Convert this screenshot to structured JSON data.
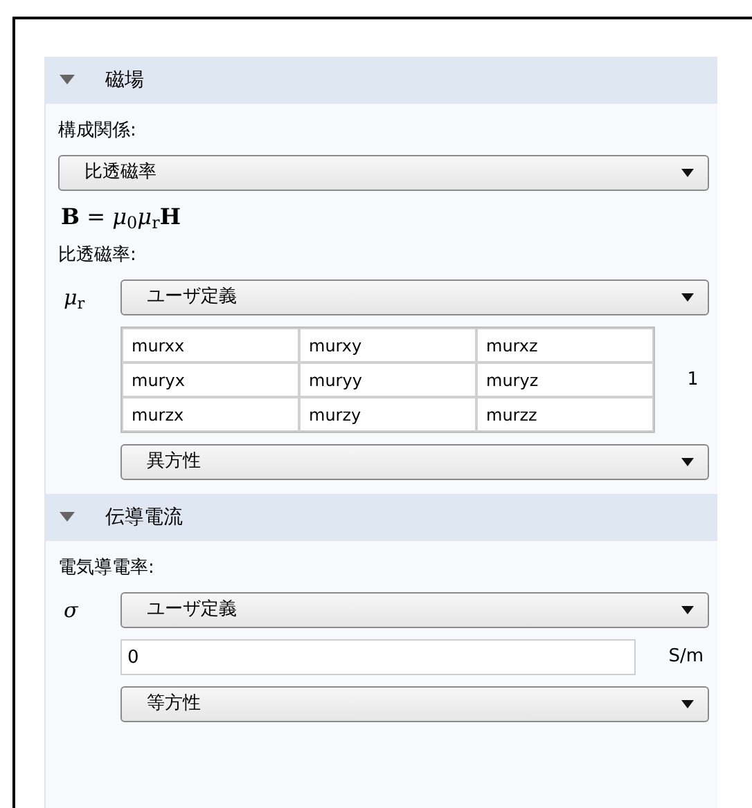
{
  "sections": [
    {
      "title": "磁場",
      "expanded": true,
      "items": [
        {
          "kind": "label",
          "text": "構成関係:"
        },
        {
          "kind": "dropdown",
          "value": "比透磁率"
        },
        {
          "kind": "formula",
          "text": "**B** = *μ*$_{0}$*μ*$_{r}$**H**"
        },
        {
          "kind": "label",
          "text": "比透磁率:"
        },
        {
          "kind": "dropdown",
          "symbol": "*μ*$_{r}$",
          "value": "ユーザ定義"
        },
        {
          "kind": "matrix",
          "rows": [
            [
              "murxx",
              "murxy",
              "murxz"
            ],
            [
              "muryx",
              "muryy",
              "muryz"
            ],
            [
              "murzx",
              "murzy",
              "murzz"
            ]
          ],
          "unit": "1"
        },
        {
          "kind": "dropdown",
          "value": "異方性"
        }
      ]
    },
    {
      "title": "伝導電流",
      "expanded": true,
      "items": [
        {
          "kind": "label",
          "text": "電気導電率:"
        },
        {
          "kind": "dropdown",
          "symbol": "*σ*",
          "value": "ユーザ定義"
        },
        {
          "kind": "input",
          "value": "0",
          "unit": "S/m"
        },
        {
          "kind": "dropdown",
          "value": "等方性"
        }
      ]
    }
  ]
}
